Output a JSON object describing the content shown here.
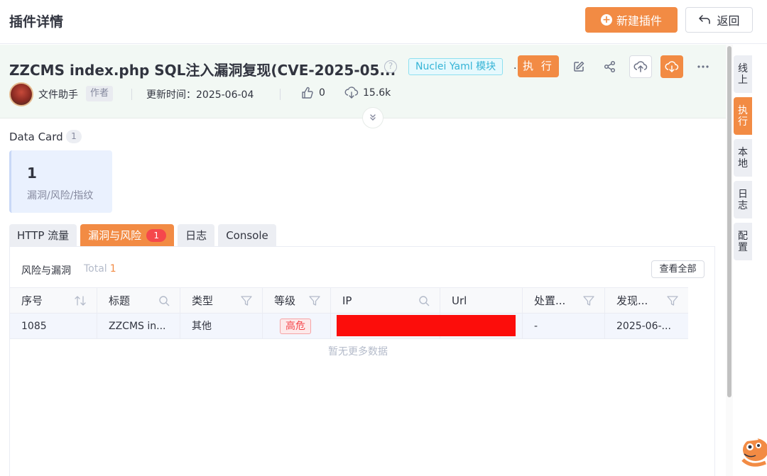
{
  "topbar": {
    "page_title": "插件详情",
    "new_plugin_label": "新建插件",
    "back_label": "返回"
  },
  "header": {
    "plugin_title": "ZZCMS index.php SQL注入漏洞复现(CVE-2025-05...",
    "type_tag": "Nuclei Yaml 模块",
    "dot": ".",
    "execute_label": "执 行",
    "author_name": "文件助手",
    "author_tag": "作者",
    "update_time": "更新时间：2025-06-04",
    "like_count": "0",
    "download_count": "15.6k"
  },
  "data_card": {
    "label": "Data Card",
    "count": "1",
    "value": "1",
    "description": "漏洞/风险/指纹"
  },
  "tabs": [
    {
      "label": "HTTP 流量"
    },
    {
      "label": "漏洞与风险",
      "badge": "1"
    },
    {
      "label": "日志"
    },
    {
      "label": "Console"
    }
  ],
  "panel": {
    "title": "风险与漏洞",
    "total_label": "Total",
    "total_value": "1",
    "view_all_label": "查看全部",
    "columns": [
      "序号",
      "标题",
      "类型",
      "等级",
      "IP",
      "Url",
      "处置...",
      "发现..."
    ],
    "rows": [
      {
        "id": "1085",
        "title": "ZZCMS in...",
        "type": "其他",
        "level": "高危",
        "ip": "",
        "url": "",
        "status": "-",
        "found": "2025-06-..."
      }
    ],
    "no_more": "暂无更多数据"
  },
  "side_tabs": [
    {
      "label": "线上"
    },
    {
      "label": "执行"
    },
    {
      "label": "本地"
    },
    {
      "label": "日志"
    },
    {
      "label": "配置"
    }
  ],
  "colors": {
    "accent": "#f28b44",
    "header_bg": "#f2f8f4",
    "danger": "#f5484c",
    "tag_cyan": "#35b4d6",
    "redaction": "#fc0d0b"
  },
  "icons": [
    "plus-circle-icon",
    "back-arrow-icon",
    "help-icon",
    "edit-icon",
    "share-icon",
    "cloud-upload-icon",
    "cloud-download-icon",
    "more-icon",
    "thumbs-up-icon",
    "download-icon",
    "chevrons-down-icon",
    "sort-icon",
    "search-icon",
    "filter-icon"
  ]
}
